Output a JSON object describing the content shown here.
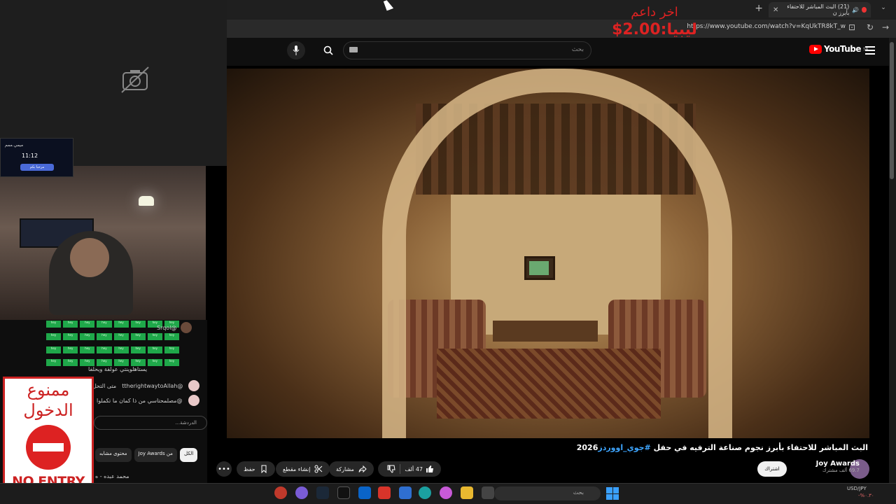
{
  "browser": {
    "tab_title": "(21) البث المباشر للاحتفاء بأبرز ن",
    "url": "https://www.youtube.com/watch?v=KqUkTR8kT_w"
  },
  "youtube": {
    "logo_text": "YouTube",
    "region": "SA",
    "search_placeholder": "بحث",
    "video_title_main": "البث المباشر للاحتفاء بأبرز نجوم صناعة الترفيه في حفل ",
    "video_title_tag": "#جوي_اووردز",
    "video_title_year": "2026",
    "channel_name": "Joy Awards",
    "channel_subs": "69.7 ألف مشترك",
    "subscribe_label": "اشتراك",
    "like_count": "47 ألف",
    "share_label": "مشاركة",
    "clip_label": "إنشاء مقطع",
    "save_label": "حفظ",
    "chips": [
      "الكل",
      "من Joy Awards",
      "محتوى مشابه"
    ]
  },
  "overlay": {
    "donor_label": "اخر داعم",
    "donor_amount": "ليبيا:2.00$"
  },
  "stream_widget": {
    "name": "ميمي.ممم",
    "time": "11:12",
    "button": "مرحبا بكم"
  },
  "chat": {
    "emote_label": "hey",
    "user1": "@Srqol",
    "line2": "يستاهلوينتي عولقة ويحلفا",
    "user2": "@ttherightwaytoAllah",
    "line3_prefix": "متى التحل",
    "line4": "@مصلمحتاسي   من ذا كمان ما تكملوا",
    "input_placeholder": "الدردشة...",
    "trailing_line": "محمد عبده - ه"
  },
  "no_entry_sign": {
    "arabic": "ممنوع الدخول",
    "english": "NO ENTRY"
  },
  "taskbar": {
    "search_placeholder": "بحث",
    "ticker_pair": "USD/JPY",
    "ticker_change": "-%٠.٣٠"
  }
}
